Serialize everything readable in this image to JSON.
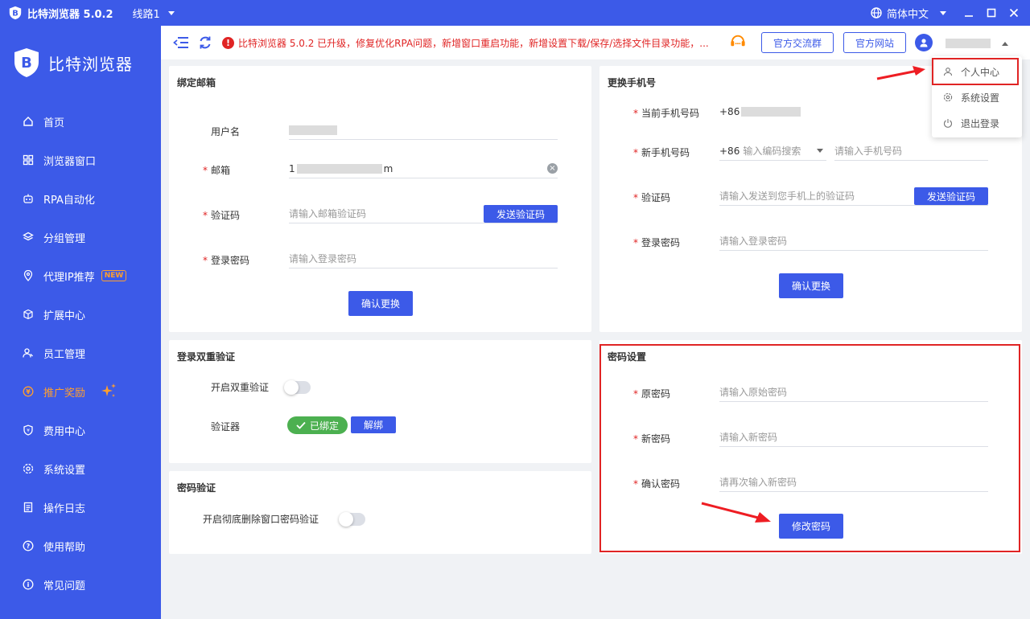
{
  "titlebar": {
    "app_title": "比特浏览器 5.0.2",
    "line": "线路1",
    "language": "简体中文"
  },
  "sidebar": {
    "brand": "比特浏览器",
    "items": [
      {
        "label": "首页",
        "icon": "home-icon"
      },
      {
        "label": "浏览器窗口",
        "icon": "grid-icon"
      },
      {
        "label": "RPA自动化",
        "icon": "robot-icon"
      },
      {
        "label": "分组管理",
        "icon": "layers-icon"
      },
      {
        "label": "代理IP推荐",
        "icon": "location-icon",
        "badge": "NEW"
      },
      {
        "label": "扩展中心",
        "icon": "cube-icon"
      },
      {
        "label": "员工管理",
        "icon": "users-icon"
      },
      {
        "label": "推广奖励",
        "icon": "reward-icon"
      },
      {
        "label": "费用中心",
        "icon": "shield-icon"
      },
      {
        "label": "系统设置",
        "icon": "gear-icon"
      },
      {
        "label": "操作日志",
        "icon": "log-icon"
      },
      {
        "label": "使用帮助",
        "icon": "help-icon"
      },
      {
        "label": "常见问题",
        "icon": "info-icon"
      }
    ]
  },
  "header": {
    "notice": "比特浏览器 5.0.2 已升级，修复优化RPA问题，新增窗口重启功能，新增设置下载/保存/选择文件目录功能，...",
    "group_button": "官方交流群",
    "site_button": "官方网站"
  },
  "user_menu": {
    "items": [
      "个人中心",
      "系统设置",
      "退出登录"
    ]
  },
  "email_card": {
    "title": "绑定邮箱",
    "username_label": "用户名",
    "email_label": "邮箱",
    "email_prefix": "1",
    "email_suffix": "m",
    "code_label": "验证码",
    "code_placeholder": "请输入邮箱验证码",
    "send_code": "发送验证码",
    "password_label": "登录密码",
    "password_placeholder": "请输入登录密码",
    "confirm": "确认更换"
  },
  "phone_card": {
    "title": "更换手机号",
    "current_label": "当前手机号码",
    "current_prefix": "+86",
    "new_label": "新手机号码",
    "code_prefix": "+86",
    "code_search_placeholder": "输入编码搜索",
    "new_placeholder": "请输入手机号码",
    "code_label": "验证码",
    "code_placeholder": "请输入发送到您手机上的验证码",
    "send_code": "发送验证码",
    "password_label": "登录密码",
    "password_placeholder": "请输入登录密码",
    "confirm": "确认更换"
  },
  "twofa_card": {
    "title": "登录双重验证",
    "enable_label": "开启双重验证",
    "authenticator_label": "验证器",
    "bound": "已绑定",
    "unbind": "解绑"
  },
  "pwdverify_card": {
    "title": "密码验证",
    "label": "开启彻底删除窗口密码验证"
  },
  "password_card": {
    "title": "密码设置",
    "old_label": "原密码",
    "old_placeholder": "请输入原始密码",
    "new_label": "新密码",
    "new_placeholder": "请输入新密码",
    "confirm_label": "确认密码",
    "confirm_placeholder": "请再次输入新密码",
    "submit": "修改密码"
  },
  "colors": {
    "primary": "#3c5ae8",
    "danger": "#e02424",
    "success": "#4cb050",
    "promo": "#ff9f2e"
  }
}
